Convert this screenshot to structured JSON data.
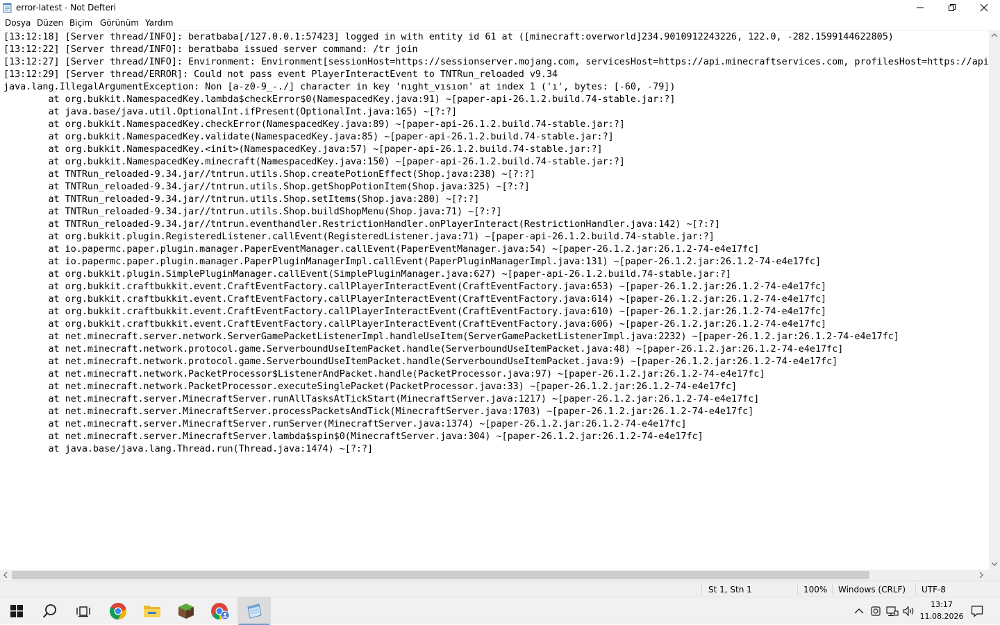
{
  "window": {
    "title": "error-latest - Not Defteri"
  },
  "menu": {
    "items": [
      "Dosya",
      "Düzen",
      "Biçim",
      "Görünüm",
      "Yardım"
    ]
  },
  "editor": {
    "lines": [
      "[13:12:18] [Server thread/INFO]: beratbaba[/127.0.0.1:57423] logged in with entity id 61 at ([minecraft:overworld]234.9010912243226, 122.0, -282.1599144622805)",
      "[13:12:22] [Server thread/INFO]: beratbaba issued server command: /tr join",
      "[13:12:27] [Server thread/INFO]: Environment: Environment[sessionHost=https://sessionserver.mojang.com, servicesHost=https://api.minecraftservices.com, profilesHost=https://api.",
      "[13:12:29] [Server thread/ERROR]: Could not pass event PlayerInteractEvent to TNTRun_reloaded v9.34",
      "java.lang.IllegalArgumentException: Non [a-z0-9_-./] character in key 'nıght_vısıon' at index 1 ('ı', bytes: [-60, -79])",
      "        at org.bukkit.NamespacedKey.lambda$checkError$0(NamespacedKey.java:91) ~[paper-api-26.1.2.build.74-stable.jar:?]",
      "        at java.base/java.util.OptionalInt.ifPresent(OptionalInt.java:165) ~[?:?]",
      "        at org.bukkit.NamespacedKey.checkError(NamespacedKey.java:89) ~[paper-api-26.1.2.build.74-stable.jar:?]",
      "        at org.bukkit.NamespacedKey.validate(NamespacedKey.java:85) ~[paper-api-26.1.2.build.74-stable.jar:?]",
      "        at org.bukkit.NamespacedKey.<init>(NamespacedKey.java:57) ~[paper-api-26.1.2.build.74-stable.jar:?]",
      "        at org.bukkit.NamespacedKey.minecraft(NamespacedKey.java:150) ~[paper-api-26.1.2.build.74-stable.jar:?]",
      "        at TNTRun_reloaded-9.34.jar//tntrun.utils.Shop.createPotionEffect(Shop.java:238) ~[?:?]",
      "        at TNTRun_reloaded-9.34.jar//tntrun.utils.Shop.getShopPotionItem(Shop.java:325) ~[?:?]",
      "        at TNTRun_reloaded-9.34.jar//tntrun.utils.Shop.setItems(Shop.java:280) ~[?:?]",
      "        at TNTRun_reloaded-9.34.jar//tntrun.utils.Shop.buildShopMenu(Shop.java:71) ~[?:?]",
      "        at TNTRun_reloaded-9.34.jar//tntrun.eventhandler.RestrictionHandler.onPlayerInteract(RestrictionHandler.java:142) ~[?:?]",
      "        at org.bukkit.plugin.RegisteredListener.callEvent(RegisteredListener.java:71) ~[paper-api-26.1.2.build.74-stable.jar:?]",
      "        at io.papermc.paper.plugin.manager.PaperEventManager.callEvent(PaperEventManager.java:54) ~[paper-26.1.2.jar:26.1.2-74-e4e17fc]",
      "        at io.papermc.paper.plugin.manager.PaperPluginManagerImpl.callEvent(PaperPluginManagerImpl.java:131) ~[paper-26.1.2.jar:26.1.2-74-e4e17fc]",
      "        at org.bukkit.plugin.SimplePluginManager.callEvent(SimplePluginManager.java:627) ~[paper-api-26.1.2.build.74-stable.jar:?]",
      "        at org.bukkit.craftbukkit.event.CraftEventFactory.callPlayerInteractEvent(CraftEventFactory.java:653) ~[paper-26.1.2.jar:26.1.2-74-e4e17fc]",
      "        at org.bukkit.craftbukkit.event.CraftEventFactory.callPlayerInteractEvent(CraftEventFactory.java:614) ~[paper-26.1.2.jar:26.1.2-74-e4e17fc]",
      "        at org.bukkit.craftbukkit.event.CraftEventFactory.callPlayerInteractEvent(CraftEventFactory.java:610) ~[paper-26.1.2.jar:26.1.2-74-e4e17fc]",
      "        at org.bukkit.craftbukkit.event.CraftEventFactory.callPlayerInteractEvent(CraftEventFactory.java:606) ~[paper-26.1.2.jar:26.1.2-74-e4e17fc]",
      "        at net.minecraft.server.network.ServerGamePacketListenerImpl.handleUseItem(ServerGamePacketListenerImpl.java:2232) ~[paper-26.1.2.jar:26.1.2-74-e4e17fc]",
      "        at net.minecraft.network.protocol.game.ServerboundUseItemPacket.handle(ServerboundUseItemPacket.java:48) ~[paper-26.1.2.jar:26.1.2-74-e4e17fc]",
      "        at net.minecraft.network.protocol.game.ServerboundUseItemPacket.handle(ServerboundUseItemPacket.java:9) ~[paper-26.1.2.jar:26.1.2-74-e4e17fc]",
      "        at net.minecraft.network.PacketProcessor$ListenerAndPacket.handle(PacketProcessor.java:97) ~[paper-26.1.2.jar:26.1.2-74-e4e17fc]",
      "        at net.minecraft.network.PacketProcessor.executeSinglePacket(PacketProcessor.java:33) ~[paper-26.1.2.jar:26.1.2-74-e4e17fc]",
      "        at net.minecraft.server.MinecraftServer.runAllTasksAtTickStart(MinecraftServer.java:1217) ~[paper-26.1.2.jar:26.1.2-74-e4e17fc]",
      "        at net.minecraft.server.MinecraftServer.processPacketsAndTick(MinecraftServer.java:1703) ~[paper-26.1.2.jar:26.1.2-74-e4e17fc]",
      "        at net.minecraft.server.MinecraftServer.runServer(MinecraftServer.java:1374) ~[paper-26.1.2.jar:26.1.2-74-e4e17fc]",
      "        at net.minecraft.server.MinecraftServer.lambda$spin$0(MinecraftServer.java:304) ~[paper-26.1.2.jar:26.1.2-74-e4e17fc]",
      "        at java.base/java.lang.Thread.run(Thread.java:1474) ~[?:?]"
    ]
  },
  "status": {
    "position": "St 1, Stn 1",
    "zoom": "100%",
    "line_ending": "Windows (CRLF)",
    "encoding": "UTF-8"
  },
  "taskbar": {
    "apps": [
      "start-icon",
      "search-icon",
      "task-view-icon",
      "chrome-icon",
      "file-explorer-icon",
      "minecraft-icon",
      "chrome-profile-icon",
      "notepad-icon"
    ],
    "clock_time": "13:17",
    "clock_date": "11.08.2026"
  },
  "colors": {
    "taskbar_bg": "#f1f1f1",
    "active_underline": "#6a9bd8",
    "scroll_thumb": "#cdcdcd"
  }
}
